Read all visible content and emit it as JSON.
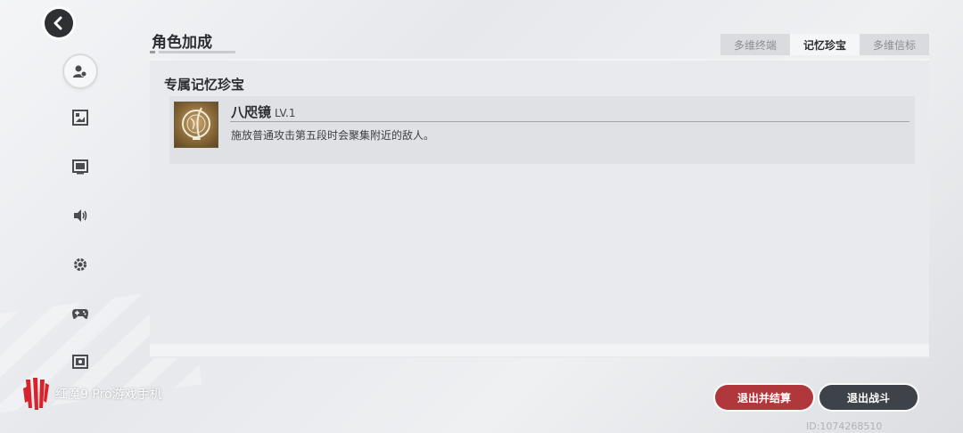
{
  "header": {
    "title": "角色加成"
  },
  "tabs": [
    {
      "label": "多维终端",
      "active": false
    },
    {
      "label": "记忆珍宝",
      "active": true
    },
    {
      "label": "多维信标",
      "active": false
    }
  ],
  "sidebar": {
    "items": [
      {
        "icon": "character-icon",
        "active": true
      },
      {
        "icon": "picture-icon",
        "active": false
      },
      {
        "icon": "screen-icon",
        "active": false
      },
      {
        "icon": "volume-icon",
        "active": false
      },
      {
        "icon": "gear-icon",
        "active": false
      },
      {
        "icon": "gamepad-icon",
        "active": false
      },
      {
        "icon": "safe-icon",
        "active": false
      }
    ]
  },
  "section": {
    "title": "专属记忆珍宝",
    "item": {
      "name": "八咫镜",
      "level": "LV.1",
      "description": "施放普通攻击第五段时会聚集附近的敌人。",
      "icon": "mirror-emblem-icon"
    }
  },
  "buttons": {
    "exit_settle": "退出并结算",
    "exit_battle": "退出战斗"
  },
  "footer": {
    "id_text": "ID:1074268510"
  },
  "watermark": {
    "text": "红魔9 Pro游戏手机"
  },
  "colors": {
    "accent_red": "#b0383c",
    "dark_button": "#3e4249",
    "panel": "#e8eaee"
  }
}
